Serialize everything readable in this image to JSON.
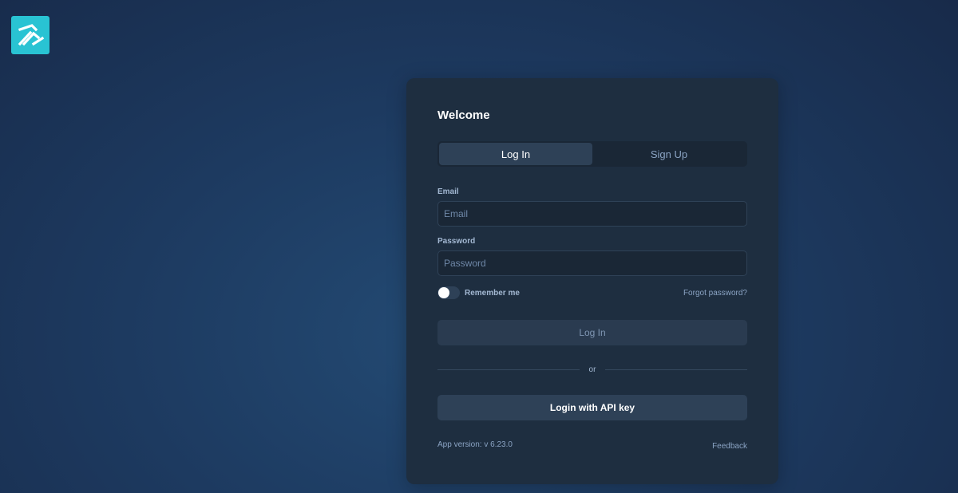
{
  "logo": {
    "icon": "brand-arrow-logo-icon",
    "color": "#29c3d3"
  },
  "card": {
    "title": "Welcome",
    "tabs": [
      {
        "label": "Log In",
        "active": true
      },
      {
        "label": "Sign Up",
        "active": false
      }
    ],
    "email": {
      "label": "Email",
      "placeholder": "Email",
      "value": ""
    },
    "password": {
      "label": "Password",
      "placeholder": "Password",
      "value": ""
    },
    "remember_me": {
      "label": "Remember me",
      "checked": false
    },
    "forgot_password": "Forgot password?",
    "login_button": "Log In",
    "divider": "or",
    "api_key_button": "Login with API key",
    "app_version": "App version: v 6.23.0",
    "feedback": "Feedback"
  }
}
